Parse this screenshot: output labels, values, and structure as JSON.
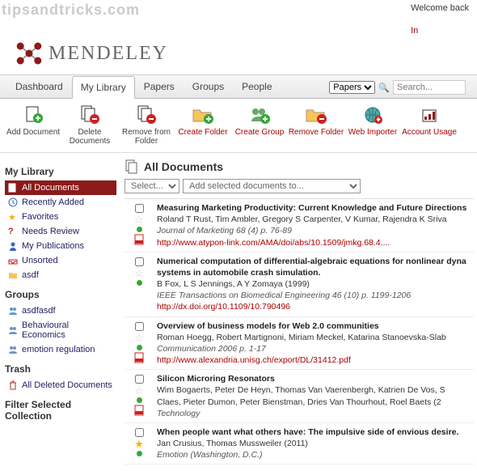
{
  "watermark": "tipsandtricks.com",
  "topbar": {
    "welcome": "Welcome back",
    "login": "In"
  },
  "brand": "MENDELEY",
  "nav": {
    "tabs": [
      "Dashboard",
      "My Library",
      "Papers",
      "Groups",
      "People"
    ],
    "active": 1,
    "papers_scope": "Papers",
    "search_placeholder": "Search..."
  },
  "toolbar": [
    {
      "label": "Add Document",
      "color": "black"
    },
    {
      "label": "Delete Documents",
      "color": "black"
    },
    {
      "label": "Remove from Folder",
      "color": "black"
    },
    {
      "label": "Create Folder",
      "color": "red"
    },
    {
      "label": "Create Group",
      "color": "red"
    },
    {
      "label": "Remove Folder",
      "color": "red"
    },
    {
      "label": "Web Importer",
      "color": "red"
    },
    {
      "label": "Account Usage",
      "color": "red"
    }
  ],
  "sidebar": {
    "library_heading": "My Library",
    "library": [
      {
        "label": "All Documents",
        "active": true
      },
      {
        "label": "Recently Added"
      },
      {
        "label": "Favorites"
      },
      {
        "label": "Needs Review"
      },
      {
        "label": "My Publications"
      },
      {
        "label": "Unsorted"
      },
      {
        "label": "asdf"
      }
    ],
    "groups_heading": "Groups",
    "groups": [
      {
        "label": "asdfasdf"
      },
      {
        "label": "Behavioural Economics"
      },
      {
        "label": "emotion regulation"
      }
    ],
    "trash_heading": "Trash",
    "trash_item": "All Deleted Documents",
    "filter_heading": "Filter Selected Collection"
  },
  "main": {
    "heading": "All Documents",
    "select_label": "Select...",
    "addto_label": "Add selected documents to...",
    "docs": [
      {
        "title": "Measuring Marketing Productivity: Current Knowledge and Future Directions",
        "authors": "Roland T Rust, Tim Ambler, Gregory S Carpenter, V Kumar, Rajendra K Sriva",
        "journal": "Journal of Marketing 68 (4) p. 76-89",
        "link": "http://www.atypon-link.com/AMA/doi/abs/10.1509/jmkg.68.4....",
        "pdf": true,
        "fav": false
      },
      {
        "title": "Numerical computation of differential-algebraic equations for nonlinear dyna\nsystems in automobile crash simulation.",
        "authors": "B Fox, L S Jennings, A Y Zomaya (1999)",
        "journal": "IEEE Transactions on Biomedical Engineering 46 (10) p. 1199-1206",
        "link": "http://dx.doi.org/10.1109/10.790496",
        "pdf": false,
        "fav": false
      },
      {
        "title": "Overview of business models for Web 2.0 communities",
        "authors": "Roman Hoegg, Robert Martignoni, Miriam Meckel, Katarina Stanoevska-Slab",
        "journal": "Communication 2006 p. 1-17",
        "link": "http://www.alexandria.unisg.ch/export/DL/31412.pdf",
        "pdf": true,
        "fav": false
      },
      {
        "title": "Silicon Microring Resonators",
        "authors": "Wim Bogaerts, Peter De Heyn, Thomas Van Vaerenbergh, Katrien De Vos, S\nClaes, Pieter Dumon, Peter Bienstman, Dries Van Thourhout, Roel Baets (2",
        "journal": "Technology",
        "link": "",
        "pdf": true,
        "fav": false
      },
      {
        "title": "When people want what others have: The impulsive side of envious desire.",
        "authors": "Jan Crusius, Thomas Mussweiler (2011)",
        "journal": "Emotion (Washington, D.C.)",
        "link": "",
        "pdf": false,
        "fav": true
      }
    ]
  }
}
